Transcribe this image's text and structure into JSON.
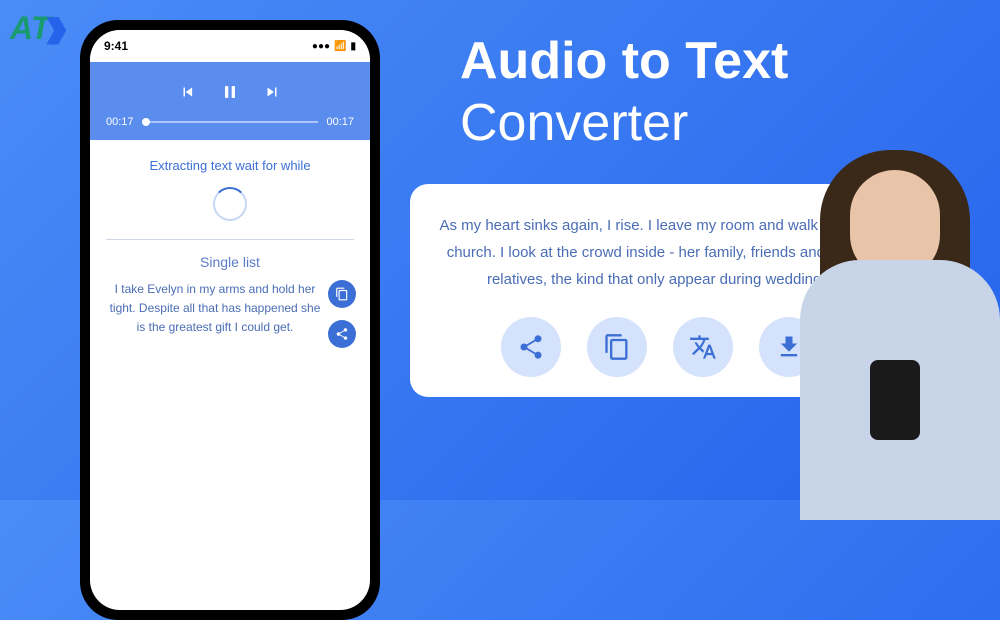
{
  "logo": "AT",
  "status": {
    "time": "9:41",
    "signal": "●●●",
    "wifi": "📶",
    "battery": "▮"
  },
  "player": {
    "time_current": "00:17",
    "time_total": "00:17"
  },
  "extracting_label": "Extracting text wait for while",
  "list": {
    "title": "Single list",
    "text": "I take Evelyn in my arms and hold her tight. Despite all that has happened she is the greatest gift I could get."
  },
  "headline": {
    "line1": "Audio to Text",
    "line2": "Converter"
  },
  "card_text": "As my heart sinks again, I rise. I leave my room and walk up to the church. I look at the crowd inside - her family, friends and distant relatives, the kind that only appear during weddings."
}
